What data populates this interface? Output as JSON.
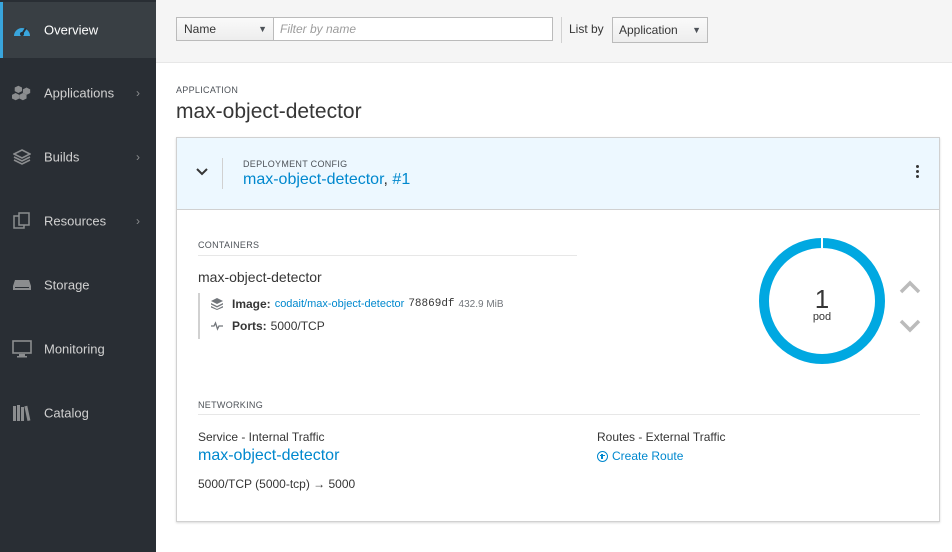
{
  "sidebar": {
    "items": [
      {
        "label": "Overview",
        "icon": "dashboard-icon",
        "active": true,
        "has_submenu": false
      },
      {
        "label": "Applications",
        "icon": "cubes-icon",
        "has_submenu": true
      },
      {
        "label": "Builds",
        "icon": "layers-icon",
        "has_submenu": true
      },
      {
        "label": "Resources",
        "icon": "files-icon",
        "has_submenu": true
      },
      {
        "label": "Storage",
        "icon": "storage-icon",
        "has_submenu": false
      },
      {
        "label": "Monitoring",
        "icon": "monitor-icon",
        "has_submenu": false
      },
      {
        "label": "Catalog",
        "icon": "catalog-icon",
        "has_submenu": false
      }
    ],
    "chevron": "›"
  },
  "filter": {
    "field_selected": "Name",
    "input_placeholder": "Filter by name",
    "input_value": "",
    "list_by_label": "List by",
    "list_by_selected": "Application"
  },
  "application": {
    "kicker": "APPLICATION",
    "name": "max-object-detector"
  },
  "deployment": {
    "kicker": "DEPLOYMENT CONFIG",
    "name": "max-object-detector",
    "separator": ",",
    "revision": "#1"
  },
  "containers": {
    "section_title": "CONTAINERS",
    "name": "max-object-detector",
    "image_label": "Image:",
    "image_link": "codait/max-object-detector",
    "image_id": "78869df",
    "image_size": "432.9 MiB",
    "ports_label": "Ports:",
    "ports_value": "5000/TCP"
  },
  "pods": {
    "count": "1",
    "label": "pod",
    "ring_color": "#00a8e1",
    "ring_fraction": 1.0
  },
  "networking": {
    "section_title": "NETWORKING",
    "service_label": "Service - Internal Traffic",
    "service_name": "max-object-detector",
    "service_ports": "5000/TCP (5000-tcp) → 5000",
    "routes_label": "Routes - External Traffic",
    "create_route": "Create Route"
  },
  "colors": {
    "sidebar_bg": "#292e34",
    "link": "#0088ce",
    "card_header_bg": "#edf8ff"
  }
}
